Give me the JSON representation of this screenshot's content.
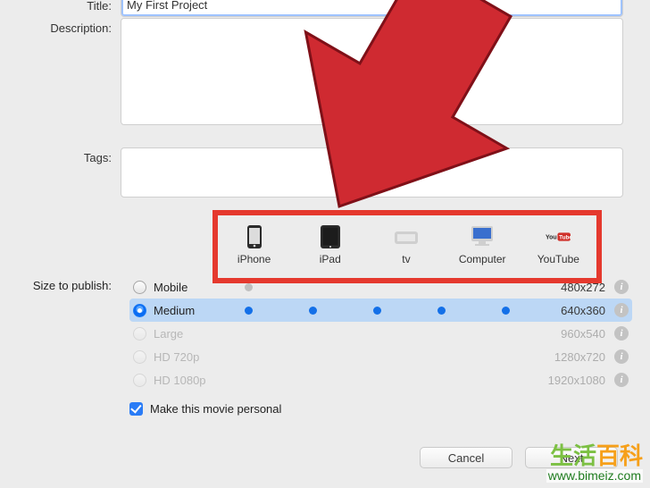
{
  "form": {
    "title_label": "Title:",
    "title_value": "My First Project",
    "description_label": "Description:",
    "tags_label": "Tags:"
  },
  "devices": {
    "columns": [
      {
        "label": "iPhone"
      },
      {
        "label": "iPad"
      },
      {
        "label": "tv"
      },
      {
        "label": "Computer"
      },
      {
        "label": "YouTube"
      }
    ]
  },
  "publish": {
    "heading": "Size to publish:",
    "options": [
      {
        "label": "Mobile",
        "dimensions": "480x272",
        "enabled": true,
        "selected": false,
        "compat": [
          true,
          false,
          false,
          false,
          false
        ]
      },
      {
        "label": "Medium",
        "dimensions": "640x360",
        "enabled": true,
        "selected": true,
        "compat": [
          true,
          true,
          true,
          true,
          true
        ]
      },
      {
        "label": "Large",
        "dimensions": "960x540",
        "enabled": false,
        "selected": false,
        "compat": [
          false,
          false,
          false,
          false,
          false
        ]
      },
      {
        "label": "HD 720p",
        "dimensions": "1280x720",
        "enabled": false,
        "selected": false,
        "compat": [
          false,
          false,
          false,
          false,
          false
        ]
      },
      {
        "label": "HD 1080p",
        "dimensions": "1920x1080",
        "enabled": false,
        "selected": false,
        "compat": [
          false,
          false,
          false,
          false,
          false
        ]
      }
    ],
    "personal_label": "Make this movie personal",
    "personal_checked": true
  },
  "buttons": {
    "cancel": "Cancel",
    "next": "Next"
  },
  "watermark": {
    "text_a": "生活",
    "text_b": "百科",
    "url": "www.bimeiz.com"
  }
}
